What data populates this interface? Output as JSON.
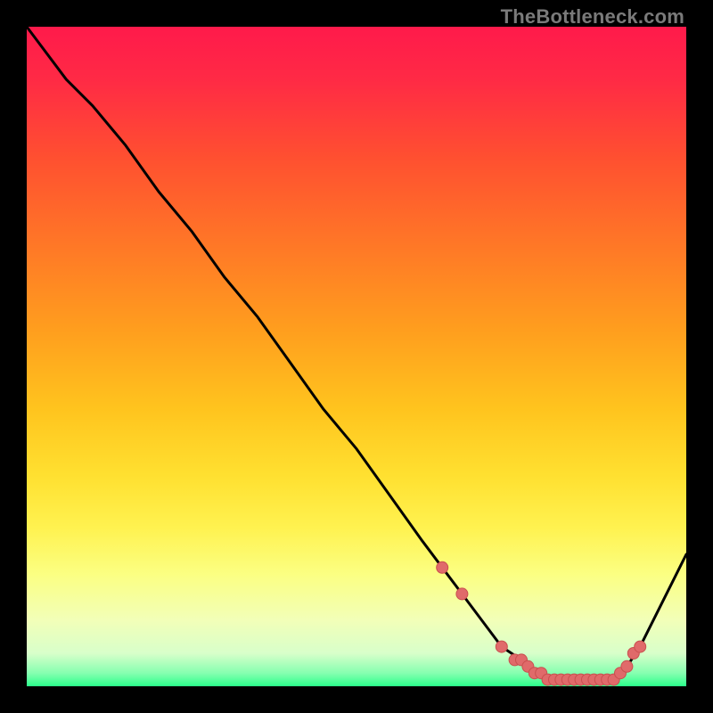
{
  "watermark": "TheBottleneck.com",
  "colors": {
    "bg_black": "#000000",
    "red_top": "#ff1a4b",
    "red": "#ff3040",
    "orange": "#ff8a2a",
    "amber": "#ffb820",
    "yellow": "#ffe63a",
    "light_yellow": "#fff873",
    "pale_yellow": "#fdffae",
    "green": "#2bff8b",
    "curve": "#000000",
    "marker_fill": "#e06a6a",
    "marker_stroke": "#c94f4f"
  },
  "chart_data": {
    "type": "line",
    "title": "",
    "xlabel": "",
    "ylabel": "",
    "xlim": [
      0,
      100
    ],
    "ylim": [
      0,
      100
    ],
    "x": [
      0,
      6,
      10,
      15,
      20,
      25,
      30,
      35,
      40,
      45,
      50,
      55,
      60,
      63,
      66,
      69,
      72,
      75,
      77,
      79,
      81,
      83,
      85,
      87,
      89,
      91,
      93,
      96,
      100
    ],
    "values": [
      100,
      92,
      88,
      82,
      75,
      69,
      62,
      56,
      49,
      42,
      36,
      29,
      22,
      18,
      14,
      10,
      6,
      4,
      2,
      1,
      1,
      1,
      1,
      1,
      1,
      3,
      6,
      12,
      20
    ],
    "markers_x": [
      63,
      66,
      72,
      74,
      75,
      76,
      77,
      78,
      79,
      80,
      81,
      82,
      83,
      84,
      85,
      86,
      87,
      88,
      89,
      90,
      91,
      92,
      93
    ],
    "markers_y": [
      18,
      14,
      6,
      4,
      4,
      3,
      2,
      2,
      1,
      1,
      1,
      1,
      1,
      1,
      1,
      1,
      1,
      1,
      1,
      2,
      3,
      5,
      6
    ]
  }
}
